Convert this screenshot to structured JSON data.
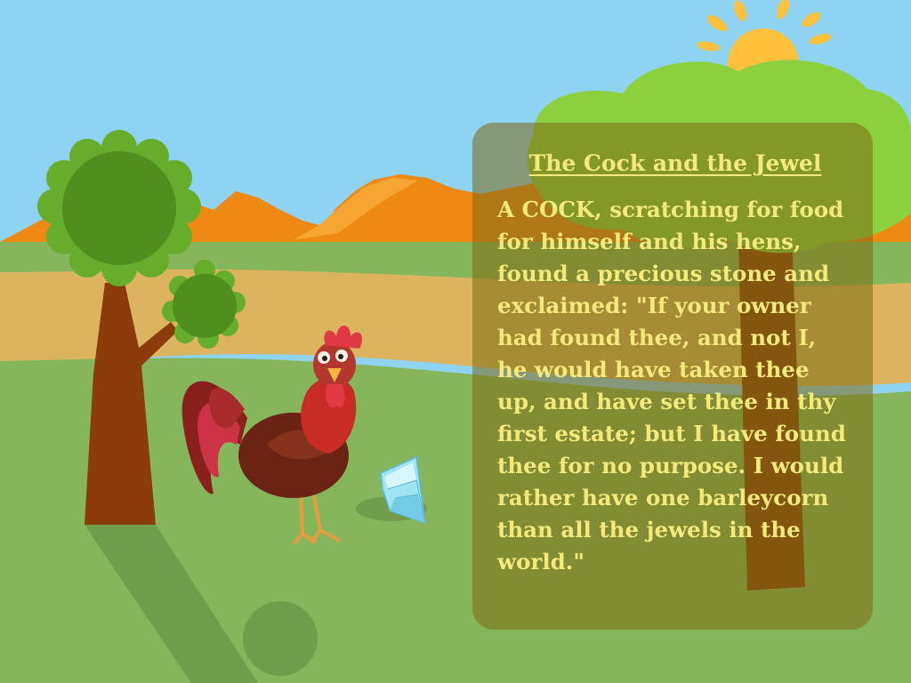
{
  "story": {
    "title": "The Cock and the Jewel",
    "body": "A COCK, scratching for food for himself and his hens, found a precious stone and exclaimed: \"If your owner had found thee, and not I, he would have taken thee up, and have set thee in thy first estate; but I have found thee for no purpose. I would rather have one barleycorn than all the jewels in the world.\""
  },
  "scene": {
    "elements": [
      "sky",
      "sun",
      "orange-mountains",
      "sand-path",
      "meadow",
      "left-tree",
      "right-tree",
      "rooster",
      "diamond-jewel",
      "tree-shadow"
    ]
  },
  "colors": {
    "sky": "#8fd3f2",
    "sun": "#ffc13b",
    "mountains": "#ee8a14",
    "sand": "#dcb35e",
    "grass": "#86b65c",
    "leaf_dark": "#4e8f1f",
    "leaf_light": "#67ad2c",
    "trunk": "#8b3c0a",
    "panel_text": "#f4ea7c"
  }
}
